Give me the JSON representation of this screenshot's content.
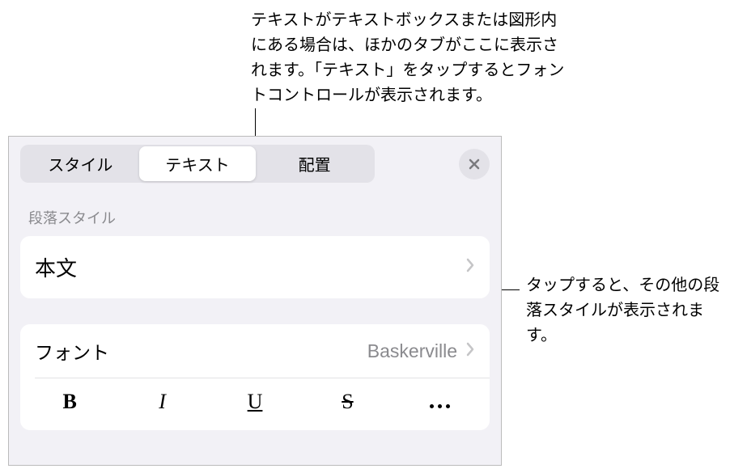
{
  "callouts": {
    "top": "テキストがテキストボックスまたは図形内にある場合は、ほかのタブがここに表示されます。「テキスト」をタップするとフォントコントロールが表示されます。",
    "right": "タップすると、その他の段落スタイルが表示されます。"
  },
  "tabs": {
    "style": "スタイル",
    "text": "テキスト",
    "arrange": "配置"
  },
  "sections": {
    "paragraph_style_label": "段落スタイル",
    "paragraph_style_value": "本文",
    "font_label": "フォント",
    "font_value": "Baskerville"
  },
  "format": {
    "bold": "B",
    "italic": "I",
    "underline": "U",
    "strike": "S"
  }
}
